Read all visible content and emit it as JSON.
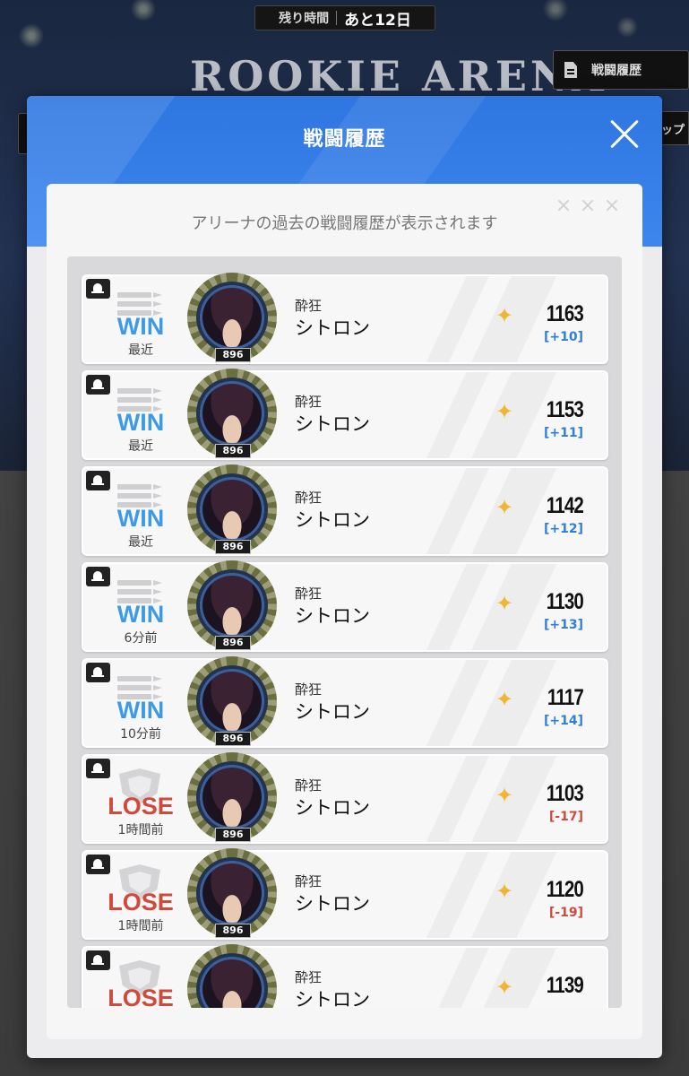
{
  "background": {
    "timer_label": "残り時間",
    "timer_value": "あと12日",
    "arena_title": "ROOKIE ARENA",
    "history_button_label": "戦闘履歴",
    "side_button_label": "ップ"
  },
  "modal": {
    "title": "戦闘履歴",
    "subtitle": "アリーナの過去の戦闘履歴が表示されます"
  },
  "colors": {
    "win": "#3d9be6",
    "lose": "#d04a3c",
    "header": "#3c86ee",
    "star": "#f1b533"
  },
  "battles": [
    {
      "result": "WIN",
      "time": "最近",
      "level": "896",
      "title": "酔狂",
      "name": "シトロン",
      "score": "1163",
      "delta": "[+10]"
    },
    {
      "result": "WIN",
      "time": "最近",
      "level": "896",
      "title": "酔狂",
      "name": "シトロン",
      "score": "1153",
      "delta": "[+11]"
    },
    {
      "result": "WIN",
      "time": "最近",
      "level": "896",
      "title": "酔狂",
      "name": "シトロン",
      "score": "1142",
      "delta": "[+12]"
    },
    {
      "result": "WIN",
      "time": "6分前",
      "level": "896",
      "title": "酔狂",
      "name": "シトロン",
      "score": "1130",
      "delta": "[+13]"
    },
    {
      "result": "WIN",
      "time": "10分前",
      "level": "896",
      "title": "酔狂",
      "name": "シトロン",
      "score": "1117",
      "delta": "[+14]"
    },
    {
      "result": "LOSE",
      "time": "1時間前",
      "level": "896",
      "title": "酔狂",
      "name": "シトロン",
      "score": "1103",
      "delta": "[-17]"
    },
    {
      "result": "LOSE",
      "time": "1時間前",
      "level": "896",
      "title": "酔狂",
      "name": "シトロン",
      "score": "1120",
      "delta": "[-19]"
    },
    {
      "result": "LOSE",
      "time": "",
      "level": "",
      "title": "酔狂",
      "name": "シトロン",
      "score": "1139",
      "delta": ""
    }
  ]
}
